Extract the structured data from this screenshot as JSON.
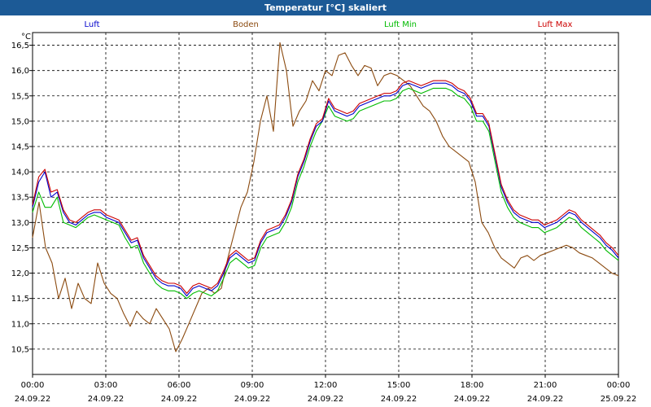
{
  "window": {
    "title": "Temperatur [°C] skaliert",
    "title_bar_color": "#1c5a96",
    "title_text_color": "#ffffff"
  },
  "chart_data": {
    "type": "line",
    "title": "Temperatur [°C] skaliert",
    "ylabel": "°C",
    "xlabel": "",
    "ylim": [
      10.0,
      16.75
    ],
    "xlim": [
      "24.09.22 00:00",
      "25.09.22 00:00"
    ],
    "grid": true,
    "legend_position": "top",
    "y_ticks": [
      "10,5",
      "11,0",
      "11,5",
      "12,0",
      "12,5",
      "13,0",
      "13,5",
      "14,0",
      "14,5",
      "15,0",
      "15,5",
      "16,0",
      "16,5"
    ],
    "x_ticks": [
      {
        "time": "00:00",
        "date": "24.09.22"
      },
      {
        "time": "03:00",
        "date": "24.09.22"
      },
      {
        "time": "06:00",
        "date": "24.09.22"
      },
      {
        "time": "09:00",
        "date": "24.09.22"
      },
      {
        "time": "12:00",
        "date": "24.09.22"
      },
      {
        "time": "15:00",
        "date": "24.09.22"
      },
      {
        "time": "18:00",
        "date": "24.09.22"
      },
      {
        "time": "21:00",
        "date": "24.09.22"
      },
      {
        "time": "00:00",
        "date": "25.09.22"
      }
    ],
    "x": [
      "00:00",
      "00:20",
      "00:30",
      "00:40",
      "00:50",
      "01:00",
      "01:10",
      "01:20",
      "01:30",
      "01:40",
      "01:50",
      "02:00",
      "02:10",
      "02:20",
      "02:30",
      "02:40",
      "02:50",
      "03:00",
      "03:10",
      "03:20",
      "03:30",
      "03:40",
      "03:50",
      "04:00",
      "04:10",
      "04:20",
      "04:30",
      "04:40",
      "04:50",
      "05:00",
      "05:10",
      "05:20",
      "05:30",
      "05:40",
      "05:50",
      "06:00",
      "06:10",
      "06:20",
      "06:30",
      "06:40",
      "06:50",
      "07:00",
      "07:10",
      "07:20",
      "07:30",
      "07:40",
      "07:50",
      "08:00",
      "08:10",
      "08:20",
      "08:30",
      "08:40",
      "08:50",
      "09:00",
      "09:10",
      "09:20",
      "09:30",
      "09:40",
      "09:50",
      "10:00",
      "10:10",
      "10:20",
      "10:30",
      "10:40",
      "10:50",
      "11:00",
      "11:10",
      "11:20",
      "11:30",
      "11:40",
      "11:50",
      "12:00",
      "12:10",
      "12:20",
      "12:30",
      "12:40",
      "12:50",
      "13:00",
      "13:10",
      "13:20",
      "13:30",
      "13:40",
      "13:50",
      "14:00",
      "14:10",
      "14:20",
      "14:30",
      "14:40",
      "14:50",
      "15:00",
      "15:10",
      "15:20",
      "15:30",
      "15:40",
      "15:50",
      "16:00",
      "16:10",
      "16:20",
      "16:30",
      "16:40",
      "16:50",
      "17:00",
      "17:10",
      "17:20",
      "17:30",
      "17:40",
      "17:50",
      "18:00",
      "18:10",
      "18:20",
      "18:30",
      "18:40",
      "18:50",
      "19:00",
      "19:10",
      "19:20",
      "19:30",
      "19:40",
      "19:50",
      "20:00",
      "20:10",
      "20:20",
      "20:30",
      "20:40",
      "20:50",
      "21:00",
      "21:10",
      "21:20",
      "21:30",
      "21:40",
      "21:50",
      "22:00",
      "22:10",
      "22:20",
      "22:30",
      "22:40",
      "22:50",
      "23:00",
      "23:10",
      "23:20",
      "23:30",
      "23:40",
      "23:50",
      "24:00"
    ],
    "series": [
      {
        "name": "Luft",
        "color": "#0000cc",
        "values": [
          13.3,
          13.8,
          14.0,
          13.5,
          13.6,
          13.2,
          13.0,
          12.95,
          13.05,
          13.15,
          13.2,
          13.2,
          13.1,
          13.05,
          13.0,
          12.8,
          12.6,
          12.65,
          12.3,
          12.1,
          11.9,
          11.8,
          11.75,
          11.75,
          11.7,
          11.55,
          11.7,
          11.75,
          11.7,
          11.65,
          11.75,
          12.0,
          12.3,
          12.4,
          12.3,
          12.2,
          12.25,
          12.6,
          12.8,
          12.85,
          12.9,
          13.1,
          13.4,
          13.9,
          14.2,
          14.6,
          14.9,
          15.0,
          15.4,
          15.2,
          15.15,
          15.1,
          15.15,
          15.3,
          15.35,
          15.4,
          15.45,
          15.5,
          15.5,
          15.55,
          15.7,
          15.75,
          15.7,
          15.65,
          15.7,
          15.75,
          15.75,
          15.75,
          15.7,
          15.6,
          15.55,
          15.4,
          15.1,
          15.1,
          14.9,
          14.3,
          13.7,
          13.4,
          13.2,
          13.1,
          13.05,
          13.0,
          13.0,
          12.9,
          12.95,
          13.0,
          13.1,
          13.2,
          13.15,
          13.0,
          12.9,
          12.8,
          12.7,
          12.55,
          12.45,
          12.3
        ]
      },
      {
        "name": "Boden",
        "color": "#8b4a0f",
        "values": [
          12.7,
          13.4,
          12.5,
          12.2,
          11.5,
          11.9,
          11.3,
          11.8,
          11.5,
          11.4,
          12.2,
          11.8,
          11.6,
          11.5,
          11.2,
          10.95,
          11.25,
          11.1,
          11.0,
          11.3,
          11.1,
          10.9,
          10.45,
          10.7,
          11.0,
          11.3,
          11.6,
          11.7,
          11.6,
          11.7,
          12.3,
          12.8,
          13.3,
          13.6,
          14.2,
          15.0,
          15.5,
          14.8,
          16.55,
          16.0,
          14.9,
          15.2,
          15.4,
          15.8,
          15.6,
          16.0,
          15.9,
          16.3,
          16.35,
          16.1,
          15.9,
          16.1,
          16.05,
          15.7,
          15.9,
          15.95,
          15.9,
          15.8,
          15.7,
          15.5,
          15.3,
          15.2,
          15.0,
          14.7,
          14.5,
          14.4,
          14.3,
          14.2,
          13.8,
          13.0,
          12.8,
          12.5,
          12.3,
          12.2,
          12.1,
          12.3,
          12.35,
          12.25,
          12.35,
          12.4,
          12.45,
          12.5,
          12.55,
          12.5,
          12.4,
          12.35,
          12.3,
          12.2,
          12.1,
          12.0,
          11.95
        ]
      },
      {
        "name": "Luft Min",
        "color": "#00bb00",
        "values": [
          13.2,
          13.6,
          13.3,
          13.3,
          13.5,
          13.0,
          12.95,
          12.9,
          13.0,
          13.1,
          13.15,
          13.1,
          13.05,
          13.0,
          12.95,
          12.7,
          12.5,
          12.55,
          12.2,
          12.0,
          11.8,
          11.7,
          11.65,
          11.65,
          11.6,
          11.5,
          11.6,
          11.65,
          11.6,
          11.55,
          11.65,
          11.9,
          12.2,
          12.3,
          12.2,
          12.1,
          12.15,
          12.5,
          12.7,
          12.75,
          12.8,
          13.0,
          13.3,
          13.8,
          14.1,
          14.5,
          14.8,
          15.0,
          15.3,
          15.1,
          15.05,
          15.0,
          15.05,
          15.2,
          15.25,
          15.3,
          15.35,
          15.4,
          15.4,
          15.45,
          15.6,
          15.65,
          15.6,
          15.55,
          15.6,
          15.65,
          15.65,
          15.65,
          15.6,
          15.5,
          15.45,
          15.3,
          15.0,
          15.0,
          14.8,
          14.2,
          13.6,
          13.3,
          13.1,
          13.0,
          12.95,
          12.9,
          12.9,
          12.8,
          12.85,
          12.9,
          13.0,
          13.1,
          13.05,
          12.9,
          12.8,
          12.7,
          12.6,
          12.45,
          12.35,
          12.25
        ]
      },
      {
        "name": "Luft Max",
        "color": "#cc0000",
        "values": [
          13.35,
          13.9,
          14.05,
          13.6,
          13.65,
          13.25,
          13.05,
          13.0,
          13.1,
          13.2,
          13.25,
          13.25,
          13.15,
          13.1,
          13.05,
          12.85,
          12.65,
          12.7,
          12.35,
          12.15,
          11.95,
          11.85,
          11.8,
          11.8,
          11.75,
          11.6,
          11.75,
          11.8,
          11.75,
          11.7,
          11.8,
          12.05,
          12.35,
          12.45,
          12.35,
          12.25,
          12.3,
          12.65,
          12.85,
          12.9,
          12.95,
          13.15,
          13.45,
          13.95,
          14.25,
          14.65,
          14.95,
          15.05,
          15.45,
          15.25,
          15.2,
          15.15,
          15.2,
          15.35,
          15.4,
          15.45,
          15.5,
          15.55,
          15.55,
          15.6,
          15.75,
          15.8,
          15.75,
          15.7,
          15.75,
          15.8,
          15.8,
          15.8,
          15.75,
          15.65,
          15.6,
          15.45,
          15.15,
          15.15,
          14.95,
          14.35,
          13.75,
          13.45,
          13.25,
          13.15,
          13.1,
          13.05,
          13.05,
          12.95,
          13.0,
          13.05,
          13.15,
          13.25,
          13.2,
          13.05,
          12.95,
          12.85,
          12.75,
          12.6,
          12.5,
          12.35
        ]
      }
    ]
  }
}
